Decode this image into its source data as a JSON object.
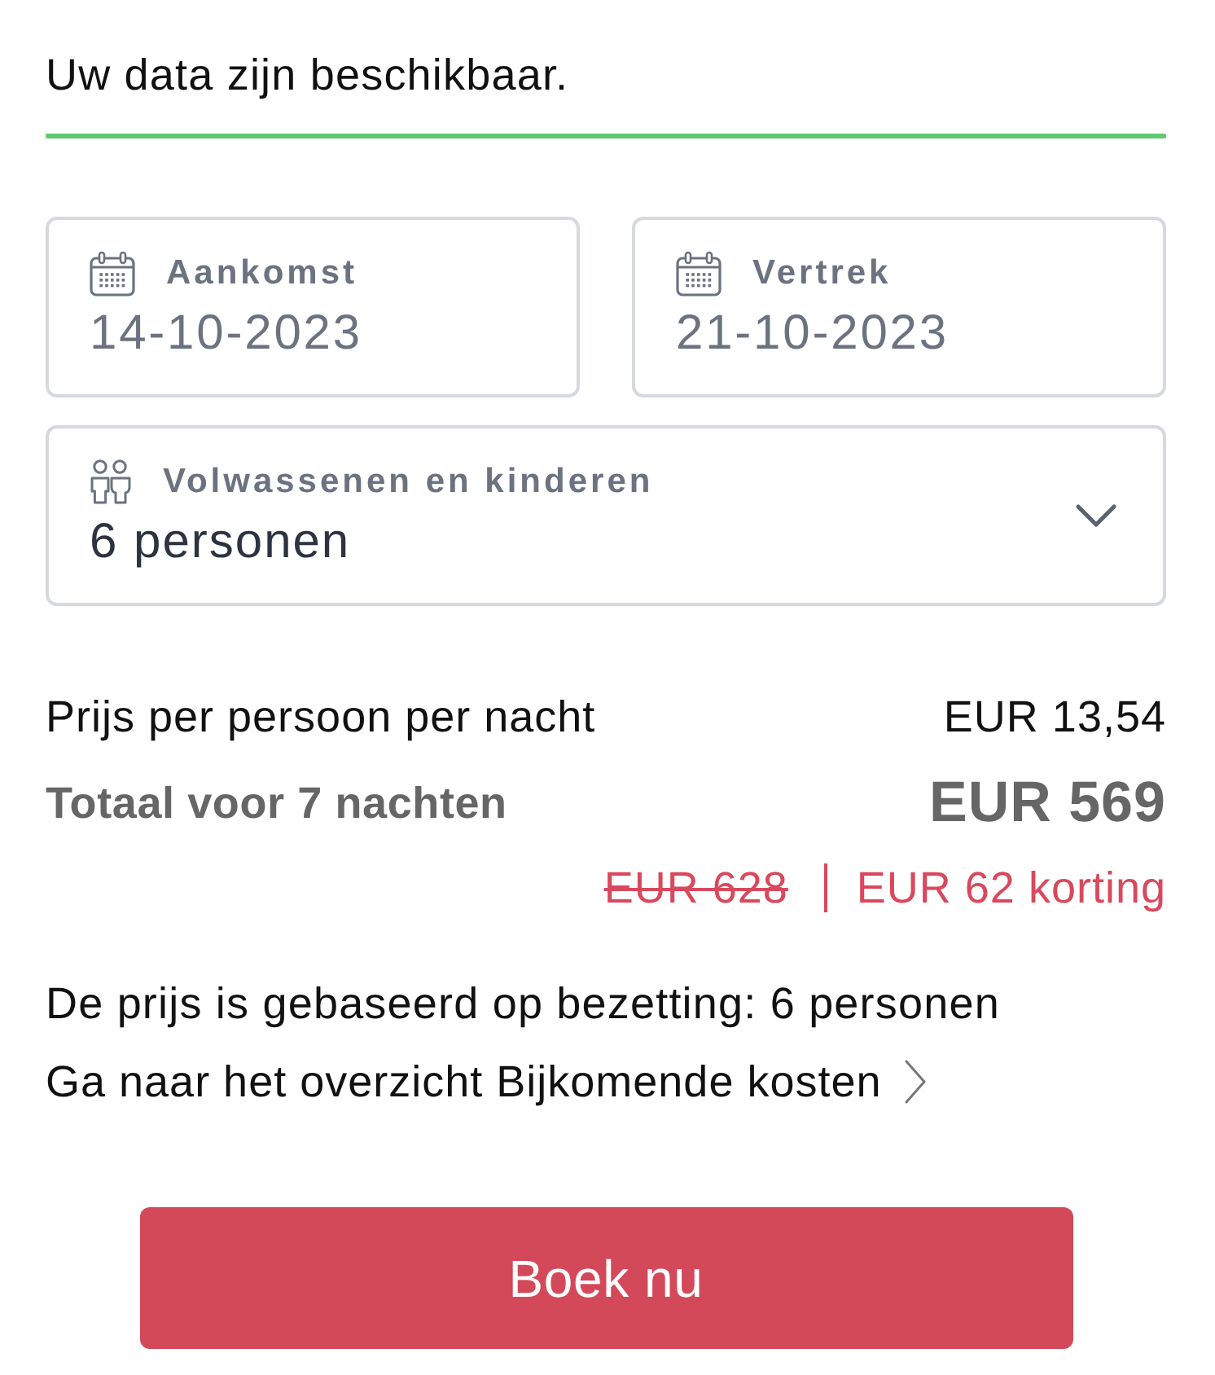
{
  "availability": {
    "message": "Uw data zijn beschikbaar."
  },
  "dates": [
    {
      "label": "Aankomst",
      "value": "14-10-2023"
    },
    {
      "label": "Vertrek",
      "value": "21-10-2023"
    }
  ],
  "guests": {
    "label": "Volwassenen en kinderen",
    "value": "6 personen",
    "expanded": false
  },
  "pricing": {
    "per_night": {
      "label": "Prijs per persoon per nacht",
      "value": "EUR 13,54"
    },
    "total": {
      "label": "Totaal voor 7 nachten",
      "value": "EUR 569"
    },
    "original_price": "EUR 628",
    "discount": "EUR 62 korting"
  },
  "occupancy_note": "De prijs is gebaseerd op bezetting: 6 personen",
  "costs_link": "Ga naar het overzicht Bijkomende kosten",
  "book_button": "Boek nu"
}
